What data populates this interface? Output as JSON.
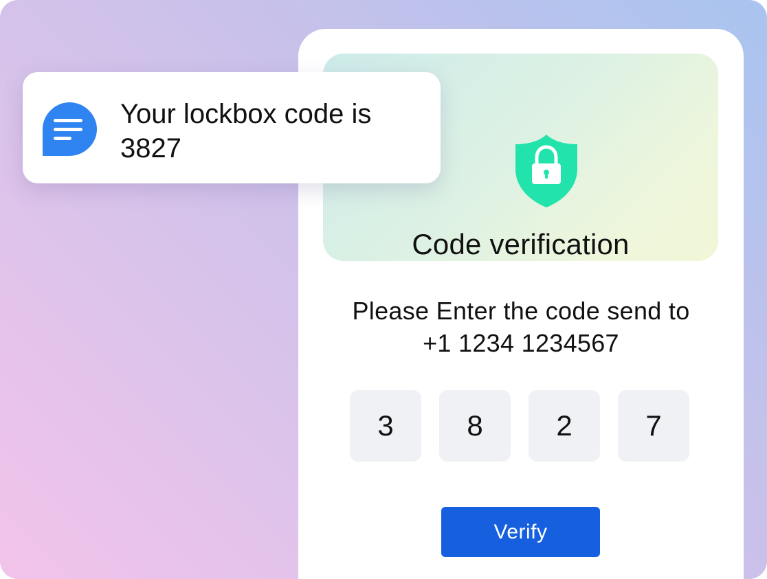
{
  "verification": {
    "title": "Code verification",
    "shield_icon": "shield-lock-icon",
    "instruction_line1": "Please Enter the code send to",
    "instruction_line2": "+1 1234 1234567",
    "code_digits": [
      "3",
      "8",
      "2",
      "7"
    ],
    "verify_label": "Verify"
  },
  "notification": {
    "icon": "message-icon",
    "line1": "Your lockbox code is",
    "line2": "3827"
  },
  "colors": {
    "accent": "#1660e0",
    "shield": "#22e3ac",
    "chat_bubble": "#2f84f1"
  }
}
